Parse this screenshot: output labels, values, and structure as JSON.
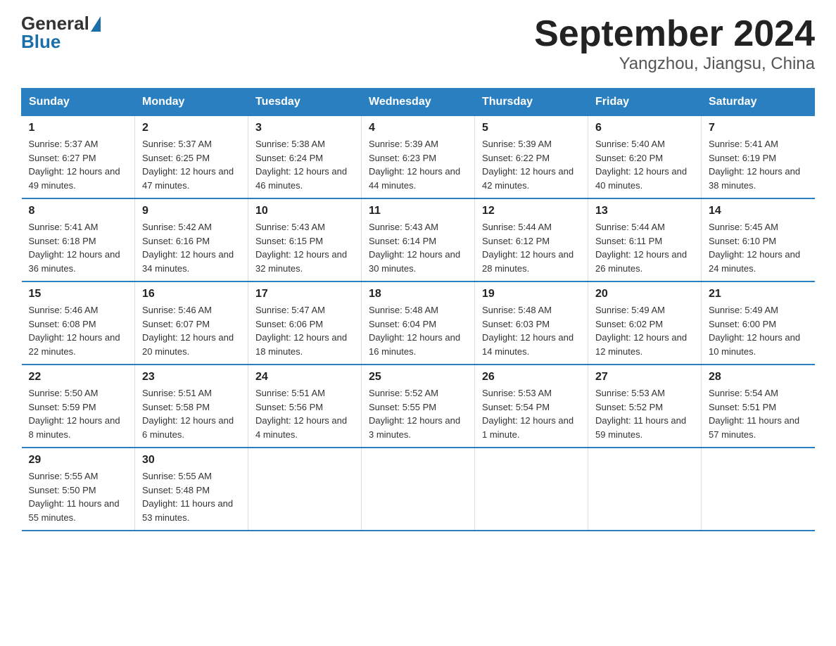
{
  "logo": {
    "general": "General",
    "blue": "Blue"
  },
  "title": "September 2024",
  "subtitle": "Yangzhou, Jiangsu, China",
  "headers": [
    "Sunday",
    "Monday",
    "Tuesday",
    "Wednesday",
    "Thursday",
    "Friday",
    "Saturday"
  ],
  "weeks": [
    [
      {
        "day": "1",
        "sunrise": "5:37 AM",
        "sunset": "6:27 PM",
        "daylight": "12 hours and 49 minutes."
      },
      {
        "day": "2",
        "sunrise": "5:37 AM",
        "sunset": "6:25 PM",
        "daylight": "12 hours and 47 minutes."
      },
      {
        "day": "3",
        "sunrise": "5:38 AM",
        "sunset": "6:24 PM",
        "daylight": "12 hours and 46 minutes."
      },
      {
        "day": "4",
        "sunrise": "5:39 AM",
        "sunset": "6:23 PM",
        "daylight": "12 hours and 44 minutes."
      },
      {
        "day": "5",
        "sunrise": "5:39 AM",
        "sunset": "6:22 PM",
        "daylight": "12 hours and 42 minutes."
      },
      {
        "day": "6",
        "sunrise": "5:40 AM",
        "sunset": "6:20 PM",
        "daylight": "12 hours and 40 minutes."
      },
      {
        "day": "7",
        "sunrise": "5:41 AM",
        "sunset": "6:19 PM",
        "daylight": "12 hours and 38 minutes."
      }
    ],
    [
      {
        "day": "8",
        "sunrise": "5:41 AM",
        "sunset": "6:18 PM",
        "daylight": "12 hours and 36 minutes."
      },
      {
        "day": "9",
        "sunrise": "5:42 AM",
        "sunset": "6:16 PM",
        "daylight": "12 hours and 34 minutes."
      },
      {
        "day": "10",
        "sunrise": "5:43 AM",
        "sunset": "6:15 PM",
        "daylight": "12 hours and 32 minutes."
      },
      {
        "day": "11",
        "sunrise": "5:43 AM",
        "sunset": "6:14 PM",
        "daylight": "12 hours and 30 minutes."
      },
      {
        "day": "12",
        "sunrise": "5:44 AM",
        "sunset": "6:12 PM",
        "daylight": "12 hours and 28 minutes."
      },
      {
        "day": "13",
        "sunrise": "5:44 AM",
        "sunset": "6:11 PM",
        "daylight": "12 hours and 26 minutes."
      },
      {
        "day": "14",
        "sunrise": "5:45 AM",
        "sunset": "6:10 PM",
        "daylight": "12 hours and 24 minutes."
      }
    ],
    [
      {
        "day": "15",
        "sunrise": "5:46 AM",
        "sunset": "6:08 PM",
        "daylight": "12 hours and 22 minutes."
      },
      {
        "day": "16",
        "sunrise": "5:46 AM",
        "sunset": "6:07 PM",
        "daylight": "12 hours and 20 minutes."
      },
      {
        "day": "17",
        "sunrise": "5:47 AM",
        "sunset": "6:06 PM",
        "daylight": "12 hours and 18 minutes."
      },
      {
        "day": "18",
        "sunrise": "5:48 AM",
        "sunset": "6:04 PM",
        "daylight": "12 hours and 16 minutes."
      },
      {
        "day": "19",
        "sunrise": "5:48 AM",
        "sunset": "6:03 PM",
        "daylight": "12 hours and 14 minutes."
      },
      {
        "day": "20",
        "sunrise": "5:49 AM",
        "sunset": "6:02 PM",
        "daylight": "12 hours and 12 minutes."
      },
      {
        "day": "21",
        "sunrise": "5:49 AM",
        "sunset": "6:00 PM",
        "daylight": "12 hours and 10 minutes."
      }
    ],
    [
      {
        "day": "22",
        "sunrise": "5:50 AM",
        "sunset": "5:59 PM",
        "daylight": "12 hours and 8 minutes."
      },
      {
        "day": "23",
        "sunrise": "5:51 AM",
        "sunset": "5:58 PM",
        "daylight": "12 hours and 6 minutes."
      },
      {
        "day": "24",
        "sunrise": "5:51 AM",
        "sunset": "5:56 PM",
        "daylight": "12 hours and 4 minutes."
      },
      {
        "day": "25",
        "sunrise": "5:52 AM",
        "sunset": "5:55 PM",
        "daylight": "12 hours and 3 minutes."
      },
      {
        "day": "26",
        "sunrise": "5:53 AM",
        "sunset": "5:54 PM",
        "daylight": "12 hours and 1 minute."
      },
      {
        "day": "27",
        "sunrise": "5:53 AM",
        "sunset": "5:52 PM",
        "daylight": "11 hours and 59 minutes."
      },
      {
        "day": "28",
        "sunrise": "5:54 AM",
        "sunset": "5:51 PM",
        "daylight": "11 hours and 57 minutes."
      }
    ],
    [
      {
        "day": "29",
        "sunrise": "5:55 AM",
        "sunset": "5:50 PM",
        "daylight": "11 hours and 55 minutes."
      },
      {
        "day": "30",
        "sunrise": "5:55 AM",
        "sunset": "5:48 PM",
        "daylight": "11 hours and 53 minutes."
      },
      null,
      null,
      null,
      null,
      null
    ]
  ]
}
